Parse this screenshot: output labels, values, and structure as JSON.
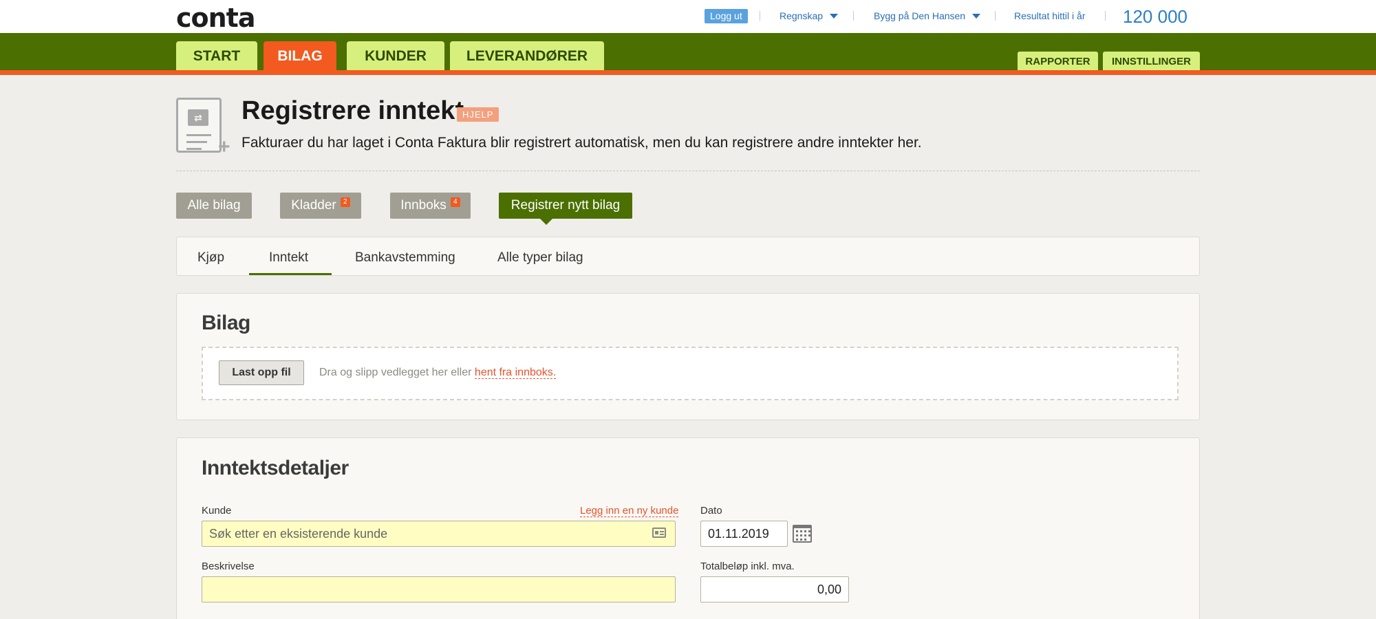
{
  "app": {
    "logo": "conta"
  },
  "topbar": {
    "logout_label": "Logg ut",
    "account_label": "Regnskap",
    "company_label": "Bygg på Den Hansen",
    "result_label": "Resultat hittil i år",
    "result_value": "120 000"
  },
  "nav": {
    "tabs": [
      {
        "label": "START"
      },
      {
        "label": "BILAG"
      },
      {
        "label": "KUNDER"
      },
      {
        "label": "LEVERANDØRER"
      }
    ],
    "active_tab": "BILAG",
    "right_tabs": [
      {
        "label": "RAPPORTER"
      },
      {
        "label": "INNSTILLINGER"
      }
    ]
  },
  "header": {
    "title": "Registrere inntekt",
    "help_label": "HJELP",
    "subtitle": "Fakturaer du har laget i Conta Faktura blir registrert automatisk, men du kan registrere andre inntekter her."
  },
  "subnav": {
    "buttons": [
      {
        "label": "Alle bilag"
      },
      {
        "label": "Kladder",
        "badge": "2"
      },
      {
        "label": "Innboks",
        "badge": "4"
      },
      {
        "label": "Registrer nytt bilag"
      }
    ]
  },
  "type_tabs": {
    "items": [
      {
        "label": "Kjøp"
      },
      {
        "label": "Inntekt"
      },
      {
        "label": "Bankavstemming"
      },
      {
        "label": "Alle typer bilag"
      }
    ],
    "active": "Inntekt"
  },
  "bilag_panel": {
    "title": "Bilag",
    "upload_label": "Last opp fil",
    "drop_text": "Dra og slipp vedlegget her eller",
    "drop_link": "hent fra innboks."
  },
  "details_panel": {
    "title": "Inntektsdetaljer",
    "customer_label": "Kunde",
    "new_customer_link": "Legg inn en ny kunde",
    "customer_placeholder": "Søk etter en eksisterende kunde",
    "date_label": "Dato",
    "date_value": "01.11.2019",
    "description_label": "Beskrivelse",
    "description_value": "",
    "total_label": "Totalbeløp inkl. mva.",
    "total_value": "0,00"
  },
  "colors": {
    "nav_green": "#4b6f00",
    "tab_lime": "#d7f07d",
    "accent_orange": "#f25a1f",
    "link_blue": "#2a6fb3",
    "input_yellow": "#fffdc2"
  }
}
